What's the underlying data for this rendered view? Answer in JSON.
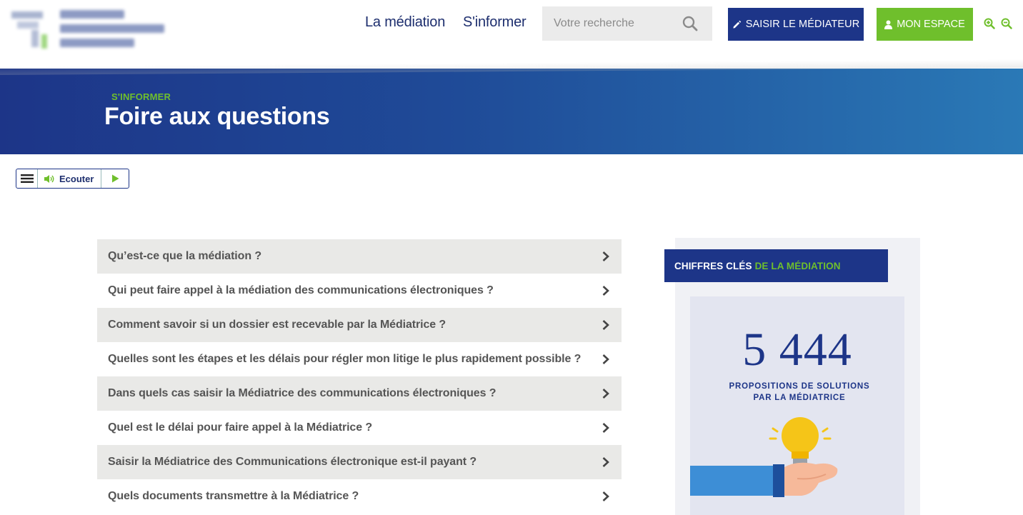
{
  "nav": {
    "mediation": "La médiation",
    "informer": "S'informer"
  },
  "search": {
    "placeholder": "Votre recherche"
  },
  "buttons": {
    "saisir": "SAISIR LE MÉDIATEUR",
    "espace": "MON ESPACE"
  },
  "banner": {
    "breadcrumb": "S'INFORMER",
    "title": "Foire aux questions"
  },
  "listen": {
    "label": "Ecouter"
  },
  "faq": [
    "Qu’est-ce que la médiation ?",
    "Qui peut faire appel à la médiation des communications électroniques ?",
    "Comment savoir si un dossier est recevable par la Médiatrice ?",
    "Quelles sont les étapes et les délais pour régler mon litige le plus rapidement possible ?",
    "Dans quels cas saisir la Médiatrice des communications électroniques ?",
    "Quel est le délai pour faire appel à la Médiatrice ?",
    "Saisir la Médiatrice des Communications électronique est-il payant ?",
    "Quels documents transmettre à la Médiatrice ?"
  ],
  "sidebar": {
    "title_main": "CHIFFRES CLÉS",
    "title_accent": "DE LA MÉDIATION",
    "stat_value": "5 444",
    "stat_label_line1": "PROPOSITIONS DE SOLUTIONS",
    "stat_label_line2": "PAR LA MÉDIATRICE"
  },
  "colors": {
    "brand_blue": "#1d3588",
    "accent_green": "#6fbf2c",
    "row_grey": "#e9e9e7"
  }
}
